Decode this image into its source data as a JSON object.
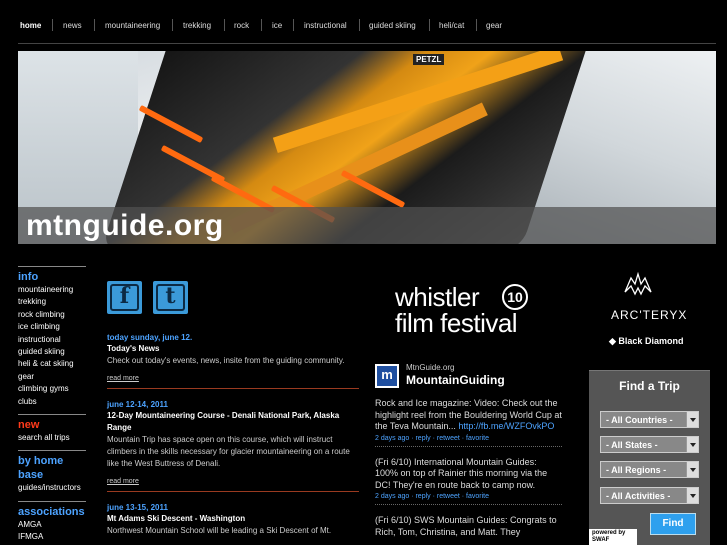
{
  "nav": {
    "items": [
      "home",
      "news",
      "mountaineering",
      "trekking",
      "rock",
      "ice",
      "instructional",
      "guided skiing",
      "heli/cat",
      "gear"
    ]
  },
  "hero": {
    "logo": "mtnguide.org",
    "brand_mark": "PETZL"
  },
  "sidebar": {
    "info_heading": "info",
    "info_links": [
      "mountaineering",
      "trekking",
      "rock climbing",
      "ice climbing",
      "instructional",
      "guided skiing",
      "heli & cat skiing",
      "gear",
      "climbing gyms",
      "clubs"
    ],
    "new_heading": "new",
    "new_links": [
      "search all trips"
    ],
    "byhome_heading_1": "by home",
    "byhome_heading_2": "base",
    "byhome_links": [
      "guides/instructors"
    ],
    "assoc_heading": "associations",
    "assoc_links": [
      "AMGA",
      "IFMGA"
    ]
  },
  "social": {
    "facebook": "f",
    "twitter": "t"
  },
  "news": [
    {
      "date": "today sunday, june 12.",
      "title": "Today's News",
      "body": "Check out today's events, news, insite from the guiding community.",
      "more": "read more"
    },
    {
      "date": "june 12-14, 2011",
      "title": "12-Day Mountaineering Course - Denali National Park, Alaska Range",
      "body": "Mountain Trip has space open on this course, which will instruct climbers in the skills necessary for glacier mountaineering on a route like the West Buttress of Denali.",
      "more": "read more"
    },
    {
      "date": "june 13-15, 2011",
      "title": "Mt Adams Ski Descent - Washington",
      "body": "Northwest Mountain School will be leading a Ski Descent of Mt.",
      "more": ""
    }
  ],
  "ad_whistler": {
    "line1": "whistler",
    "line2": "film festival",
    "badge": "10"
  },
  "twitter": {
    "handle": "MtnGuide.org",
    "name": "MountainGuiding",
    "tweets": [
      {
        "text": "Rock and Ice magazine: Video: Check out the highlight reel from the Bouldering World Cup at the Teva Mountain...",
        "link": "http://fb.me/WZFOvkPO",
        "meta": "2 days ago · reply · retweet · favorite"
      },
      {
        "text": "(Fri 6/10) International Mountain Guides: 100% on top of Rainier this morning via the DC! They're en route back to camp now.",
        "link": "",
        "meta": "2 days ago · reply · retweet · favorite"
      },
      {
        "text": "(Fri 6/10) SWS Mountain Guides: Congrats to Rich, Tom, Christina, and Matt. They",
        "link": "",
        "meta": ""
      }
    ]
  },
  "ad_arc": {
    "brand1": "ARC'TERYX",
    "brand2": "Black Diamond"
  },
  "find_trip": {
    "title": "Find a Trip",
    "countries": "- All Countries -",
    "states": "- All States -",
    "regions": "- All Regions -",
    "activities": "- All Activities -",
    "button": "Find"
  },
  "powered": "powered by SWAF"
}
